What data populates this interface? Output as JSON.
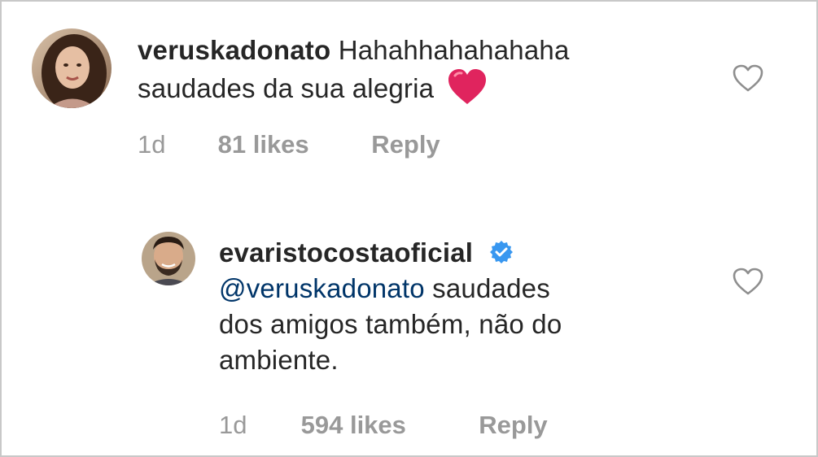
{
  "comments": [
    {
      "username": "veruskadonato",
      "text_line1": "Hahahhahahahaha",
      "text_line2": "saudades da sua alegria",
      "emoji": "red-heart",
      "time": "1d",
      "likes": "81 likes",
      "reply_label": "Reply"
    },
    {
      "username": "evaristocostaoficial",
      "verified": true,
      "mention": "@veruskadonato",
      "text_line1": "saudades",
      "text_line2": "dos amigos também, não do",
      "text_line3": "ambiente.",
      "time": "1d",
      "likes": "594 likes",
      "reply_label": "Reply"
    }
  ],
  "icons": {
    "like": "heart-outline-icon",
    "verified": "verified-badge-icon",
    "emoji": "red-heart-emoji"
  },
  "colors": {
    "text": "#262626",
    "meta": "#999999",
    "mention": "#003569",
    "verified": "#3897f0",
    "heart_emoji": "#e0245e",
    "border": "#c8c8c8"
  }
}
